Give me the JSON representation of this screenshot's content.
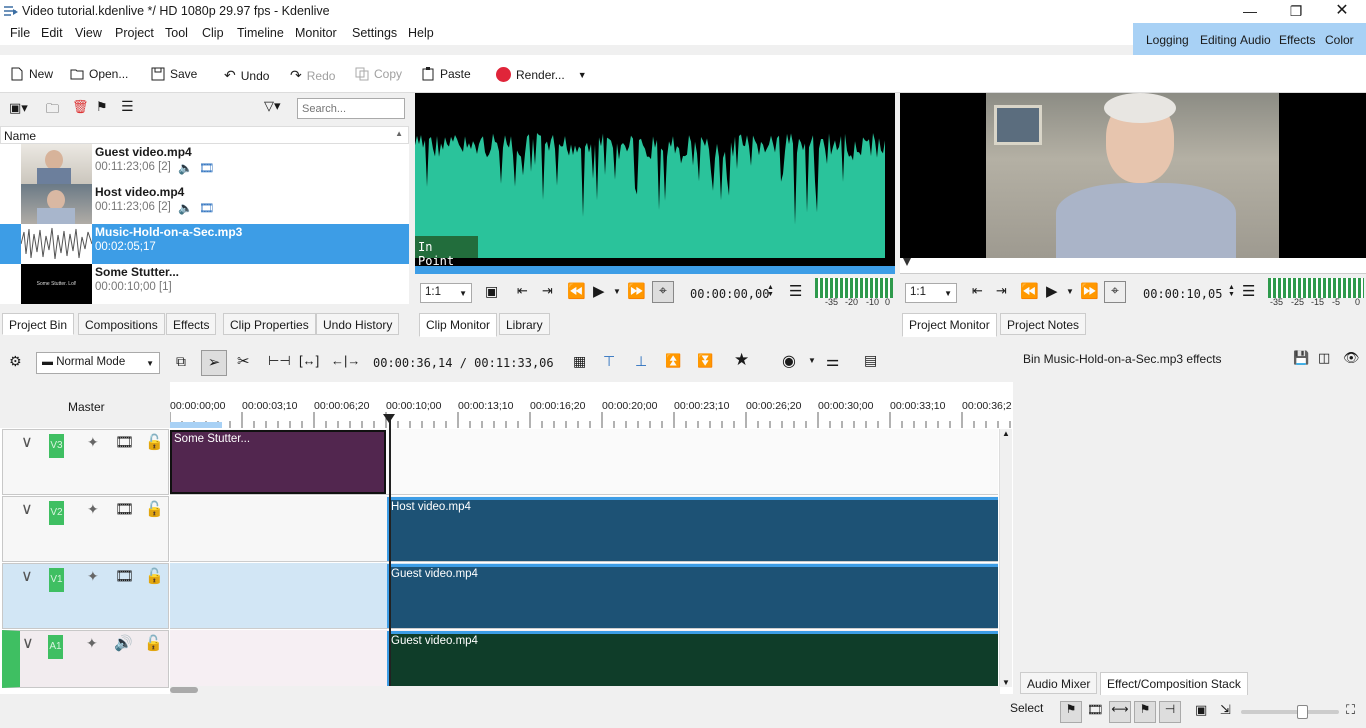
{
  "window": {
    "title": "Video tutorial.kdenlive */ HD 1080p 29.97 fps - Kdenlive"
  },
  "menu": [
    "File",
    "Edit",
    "View",
    "Project",
    "Tool",
    "Clip",
    "Timeline",
    "Monitor",
    "Settings",
    "Help"
  ],
  "workspaces": [
    "Logging",
    "Editing",
    "Audio",
    "Effects",
    "Color"
  ],
  "toolbar": {
    "new": "New",
    "open": "Open...",
    "save": "Save",
    "undo": "Undo",
    "redo": "Redo",
    "copy": "Copy",
    "paste": "Paste",
    "render": "Render..."
  },
  "bin": {
    "search_placeholder": "Search...",
    "column_name": "Name",
    "items": [
      {
        "name": "Guest video.mp4",
        "tc": "00:11:23;06 [2]"
      },
      {
        "name": "Host video.mp4",
        "tc": "00:11:23;06 [2]"
      },
      {
        "name": "Music-Hold-on-a-Sec.mp3",
        "tc": "00:02:05;17"
      },
      {
        "name": "Some Stutter...",
        "tc": "00:00:10;00 [1]",
        "thumb_text": "Some Stutter. Lol!"
      }
    ],
    "tabs": [
      "Project Bin",
      "Compositions",
      "Effects",
      "Clip Properties",
      "Undo History"
    ]
  },
  "clip_monitor": {
    "marker": "In Point",
    "zoom": "1:1",
    "timecode": "00:00:00,00",
    "vu_labels": [
      "-35",
      "-20",
      "-10",
      "0"
    ],
    "tabs": [
      "Clip Monitor",
      "Library"
    ]
  },
  "project_monitor": {
    "zoom": "1:1",
    "timecode": "00:00:10,05",
    "vu_labels": [
      "-35",
      "-25",
      "-15",
      "-5",
      "0"
    ],
    "tabs": [
      "Project Monitor",
      "Project Notes"
    ]
  },
  "timeline": {
    "mode": "Normal Mode",
    "position": "00:00:36,14 / 00:11:33,06",
    "master": "Master",
    "ruler": [
      "00:00:00;00",
      "00:00:03;10",
      "00:00:06;20",
      "00:00:10;00",
      "00:00:13;10",
      "00:00:16;20",
      "00:00:20;00",
      "00:00:23;10",
      "00:00:26;20",
      "00:00:30;00",
      "00:00:33;10",
      "00:00:36;2"
    ],
    "tracks": [
      {
        "name": "V3",
        "clips": [
          {
            "label": "Some Stutter..."
          }
        ]
      },
      {
        "name": "V2",
        "clips": [
          {
            "label": "Host video.mp4"
          }
        ]
      },
      {
        "name": "V1",
        "clips": [
          {
            "label": "Guest video.mp4"
          }
        ]
      },
      {
        "name": "A1",
        "clips": [
          {
            "label": "Guest video.mp4"
          }
        ]
      }
    ]
  },
  "effects_panel": {
    "title": "Bin Music-Hold-on-a-Sec.mp3 effects",
    "tabs": [
      "Audio Mixer",
      "Effect/Composition Stack"
    ]
  },
  "status": {
    "mode": "Select"
  },
  "colors": {
    "accent": "#3d9de6",
    "waveform": "#2ac39b",
    "clip_video": "#1d5275",
    "clip_audio": "#0f3d29",
    "clip_title": "#52264f",
    "track_green": "#3fbf62"
  }
}
